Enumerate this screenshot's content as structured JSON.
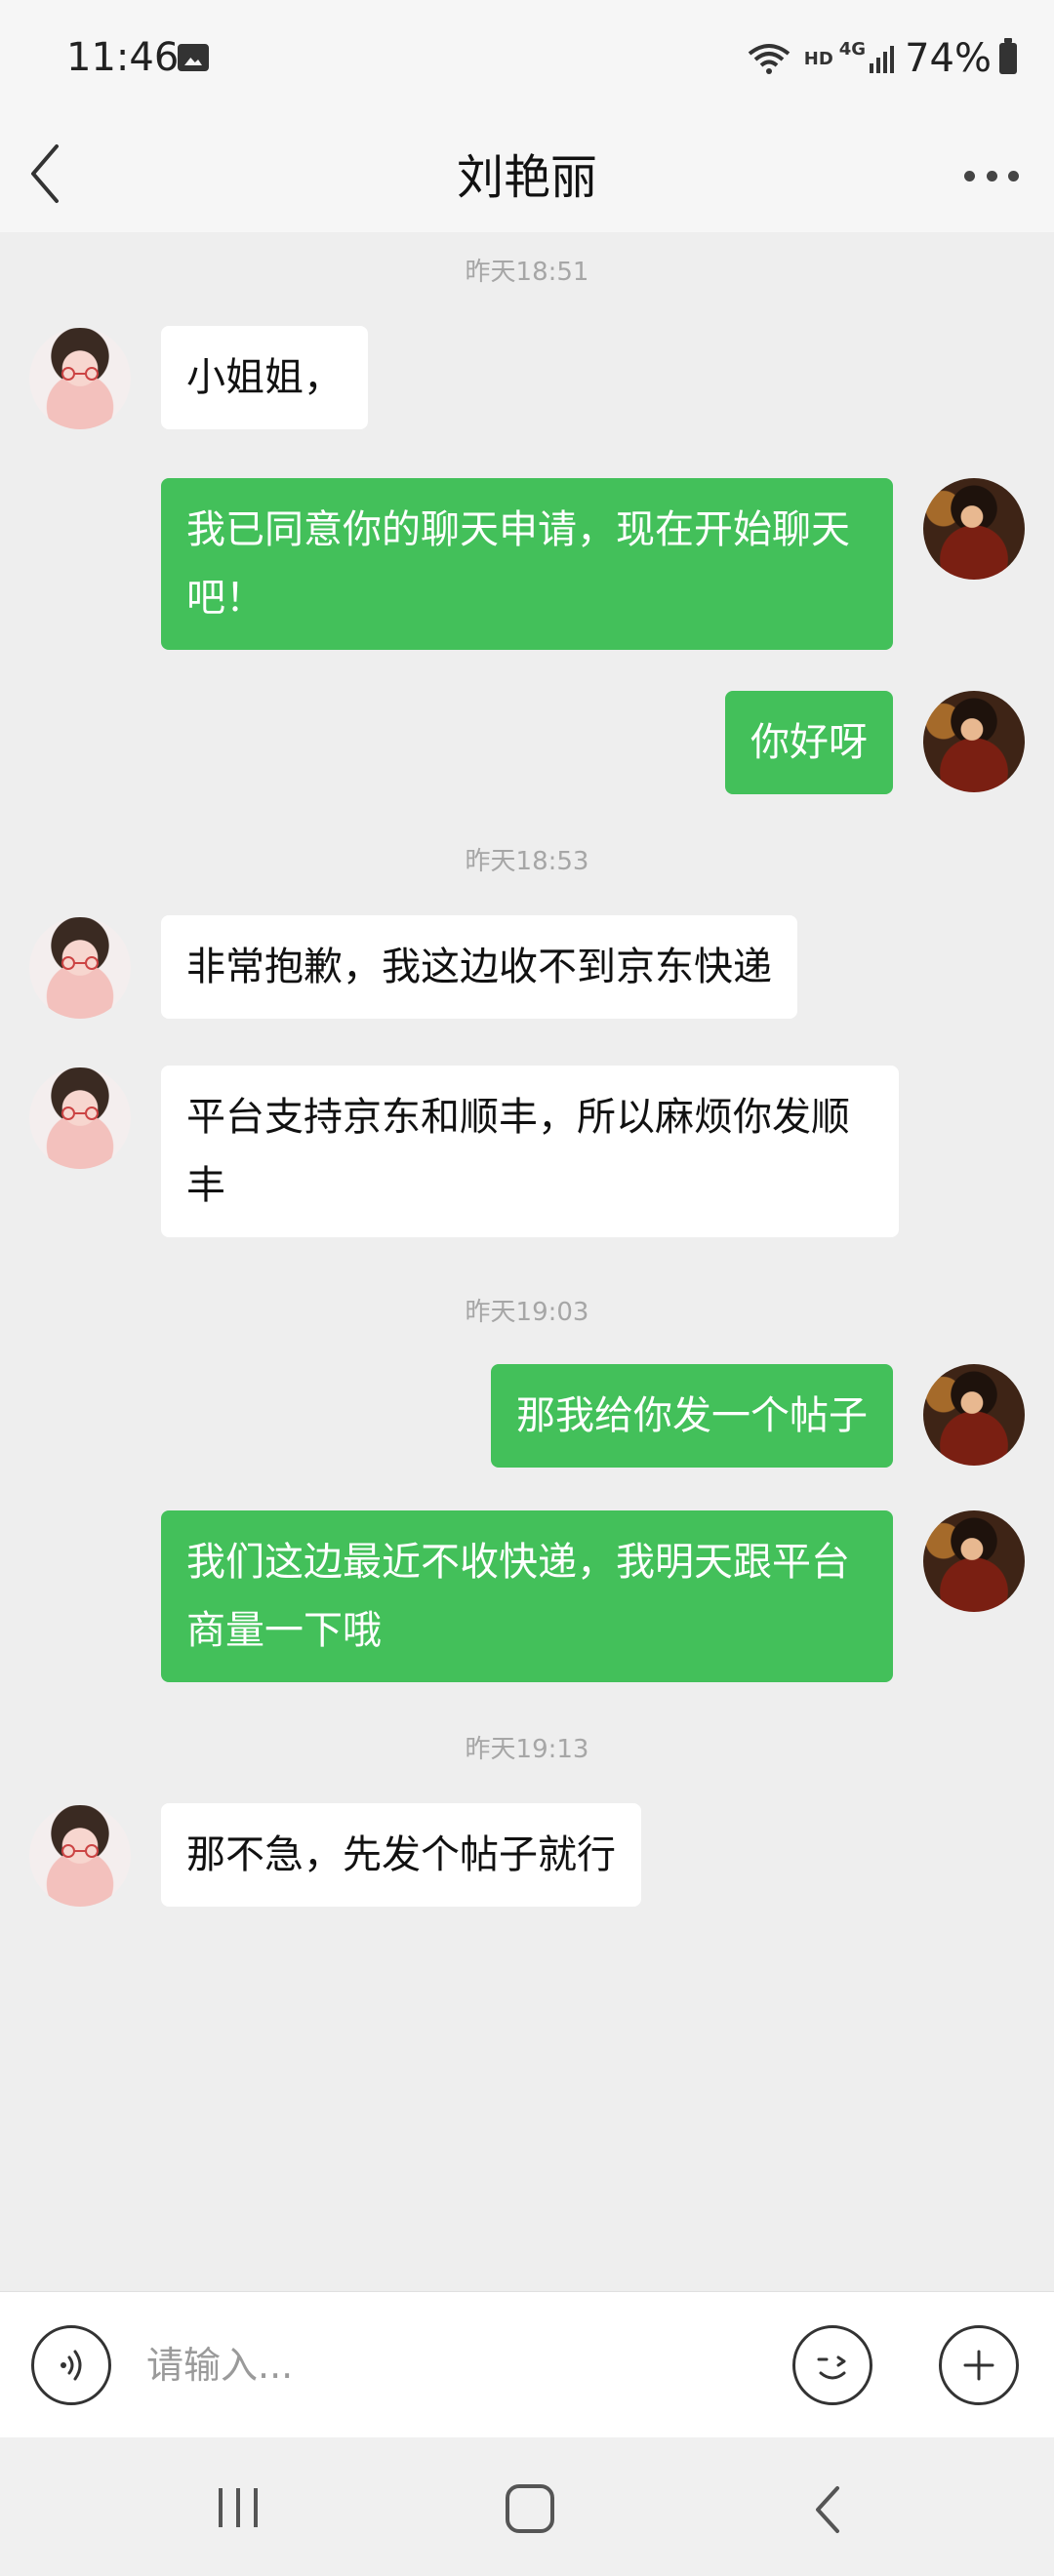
{
  "status_bar": {
    "time": "11:46",
    "hd": "HD",
    "network": "4G",
    "battery": "74%"
  },
  "header": {
    "title": "刘艳丽"
  },
  "timestamps": [
    "昨天18:51",
    "昨天18:53",
    "昨天19:03",
    "昨天19:13"
  ],
  "messages": [
    {
      "side": "in",
      "text": "小姐姐，"
    },
    {
      "side": "out",
      "text": "我已同意你的聊天申请，现在开始聊天吧！"
    },
    {
      "side": "out",
      "text": "你好呀"
    },
    {
      "side": "in",
      "text": "非常抱歉，我这边收不到京东快递"
    },
    {
      "side": "in",
      "text": "平台支持京东和顺丰，所以麻烦你发顺丰"
    },
    {
      "side": "out",
      "text": "那我给你发一个帖子"
    },
    {
      "side": "out",
      "text": "我们这边最近不收快递，我明天跟平台商量一下哦"
    },
    {
      "side": "in",
      "text": "那不急，先发个帖子就行"
    }
  ],
  "input": {
    "placeholder": "请输入..."
  },
  "colors": {
    "outgoing_bubble": "#43c05a",
    "incoming_bubble": "#ffffff",
    "background": "#eeeeee"
  },
  "icons": [
    "back-icon",
    "more-icon",
    "voice-icon",
    "emoji-icon",
    "plus-icon"
  ]
}
